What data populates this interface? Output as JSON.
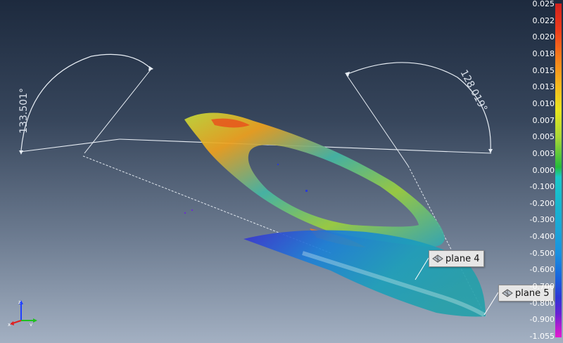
{
  "measurements": {
    "angle_1": "133.501°",
    "angle_2": "128.019°"
  },
  "planes": [
    {
      "label": "plane 4",
      "icon": "plane-icon"
    },
    {
      "label": "plane 5",
      "icon": "plane-icon"
    }
  ],
  "colorbar": {
    "labels": [
      "0.025",
      "0.022",
      "0.020",
      "0.018",
      "0.015",
      "0.013",
      "0.010",
      "0.007",
      "0.005",
      "0.003",
      "0.000",
      "-0.100",
      "-0.200",
      "-0.300",
      "-0.400",
      "-0.500",
      "-0.600",
      "-0.700",
      "-0.800",
      "-0.900",
      "-1.055"
    ],
    "max_color": "#d2221e",
    "zero_color": "#25bb3b",
    "min_color": "#e31bcf"
  },
  "axis_triad": {
    "x": "x",
    "y": "y",
    "z": "z",
    "x_color": "#e02020",
    "y_color": "#20c020",
    "z_color": "#2040ff"
  }
}
